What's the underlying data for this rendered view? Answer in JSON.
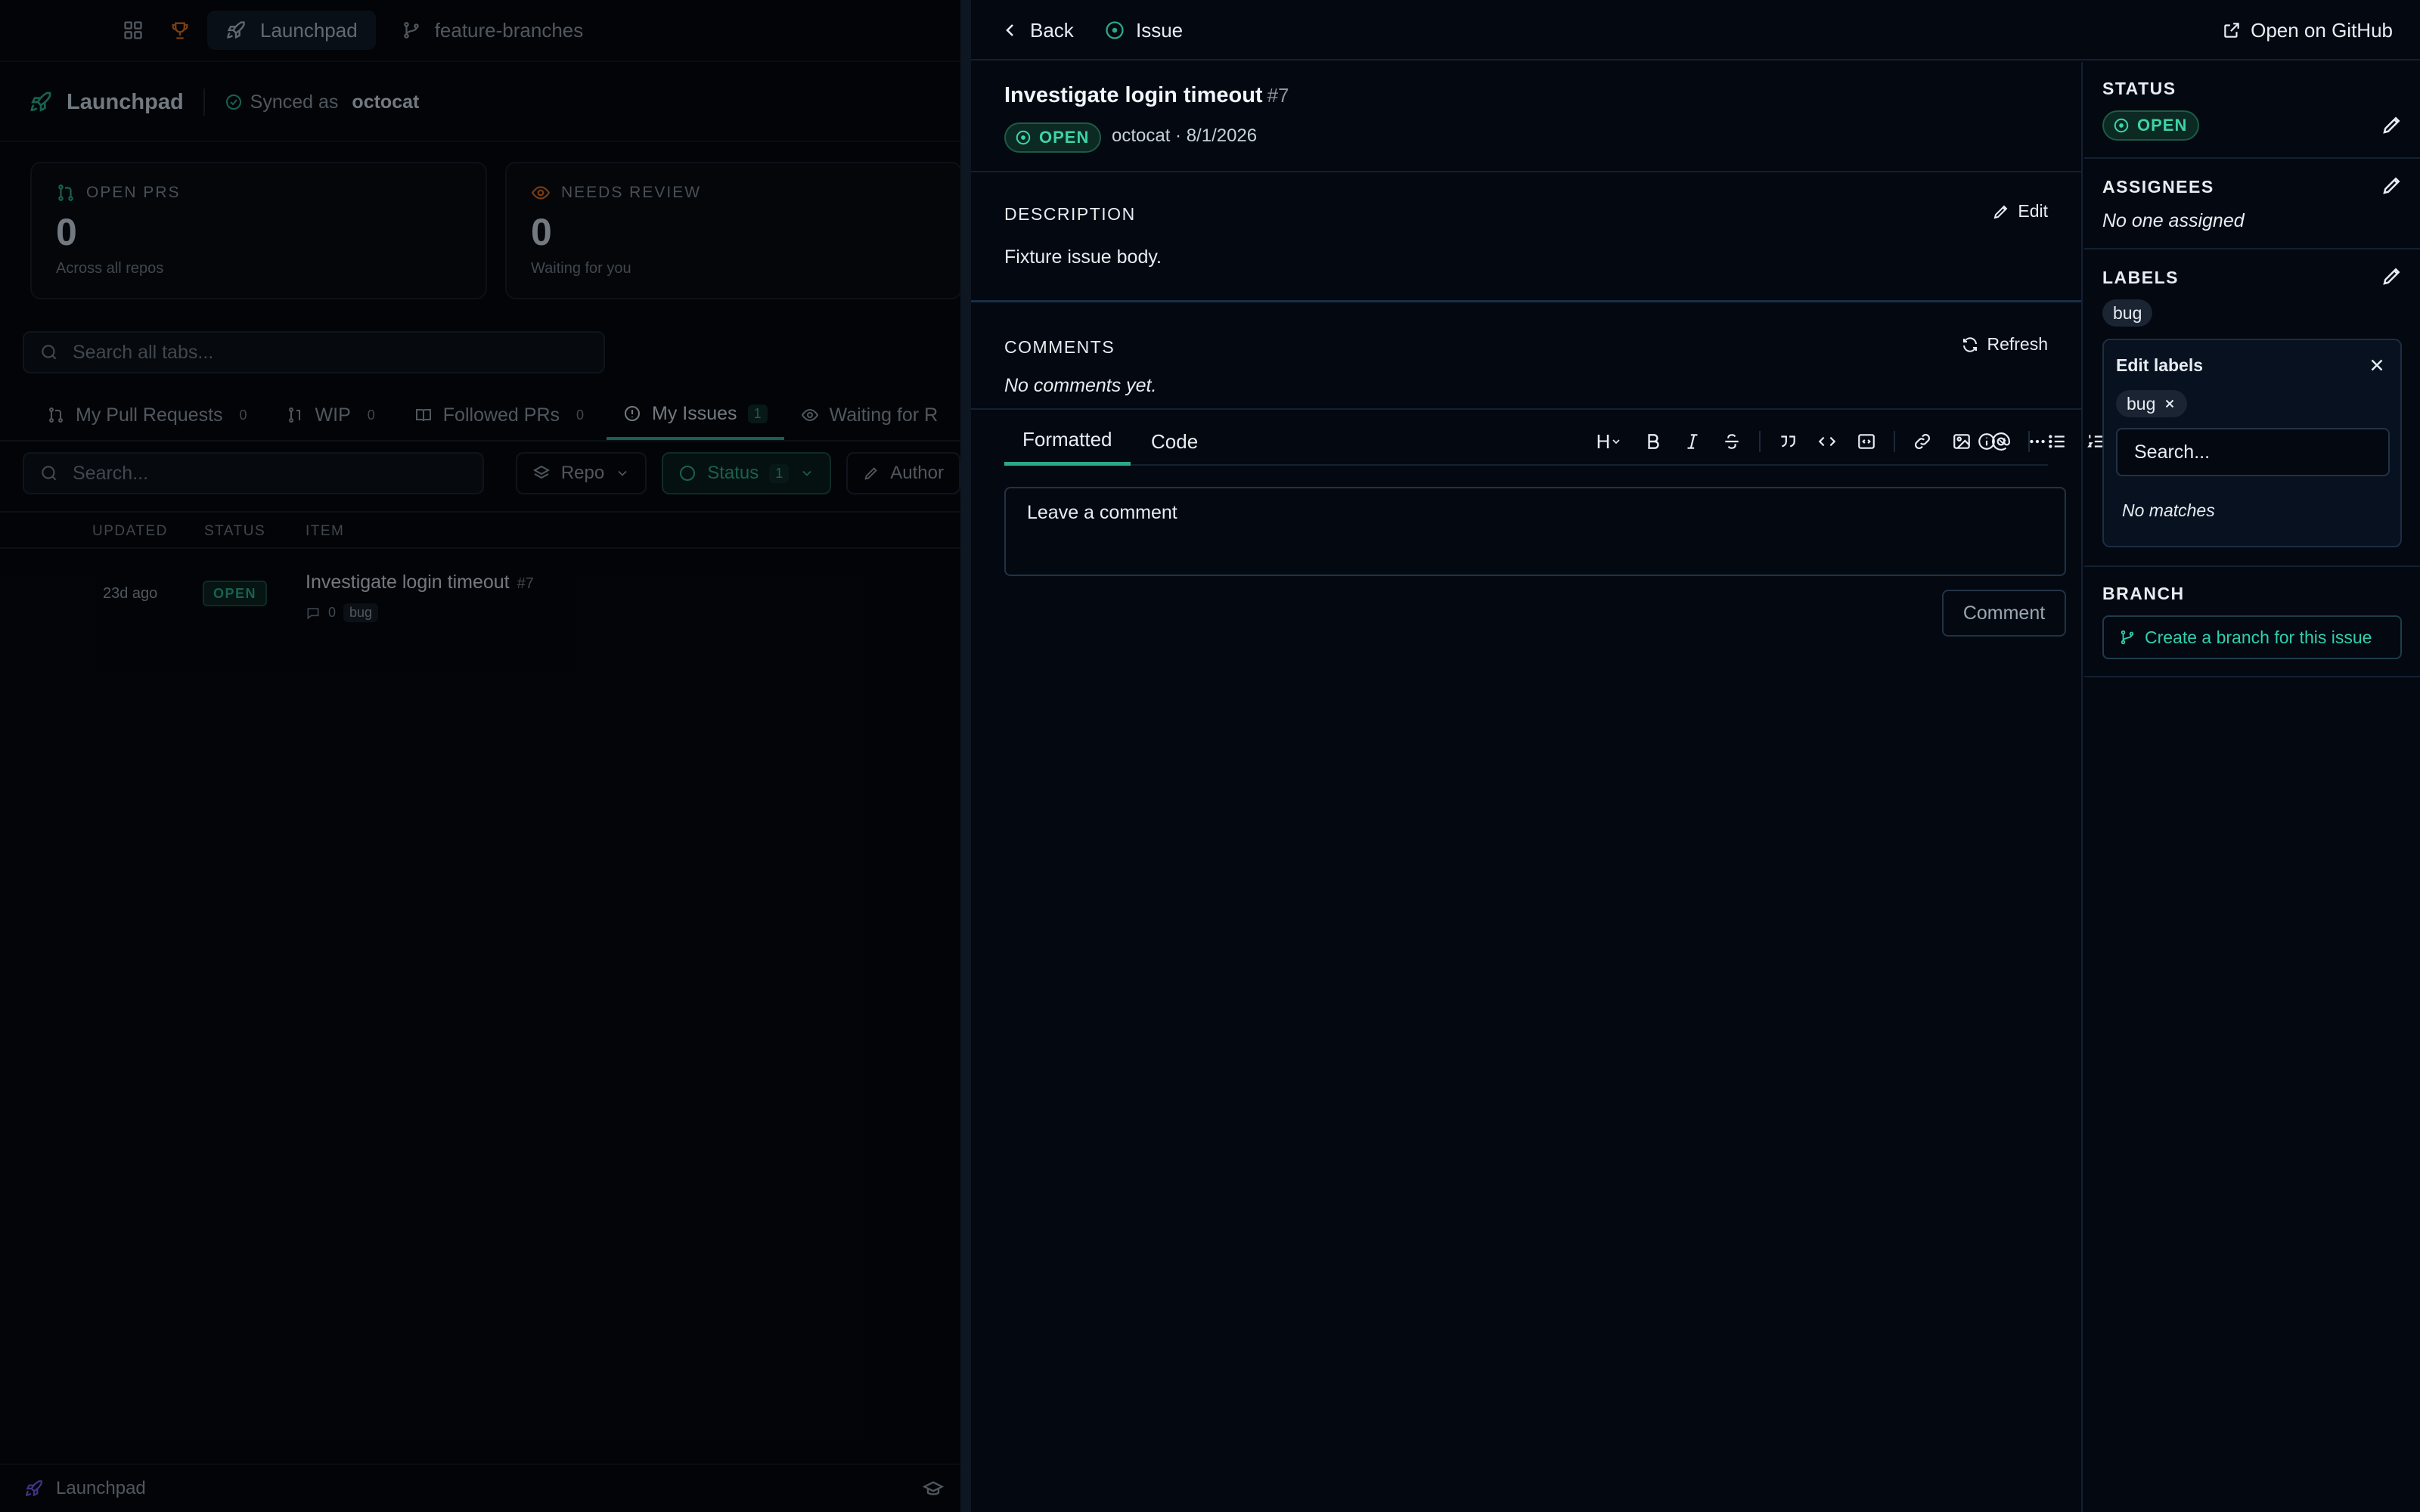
{
  "bg": {
    "nav": {
      "launchpad": "Launchpad",
      "feature_branches": "feature-branches"
    },
    "header": {
      "title": "Launchpad",
      "synced_as": "Synced as",
      "user": "octocat"
    },
    "cards": [
      {
        "label": "OPEN PRS",
        "value": "0",
        "sub": "Across all repos"
      },
      {
        "label": "NEEDS REVIEW",
        "value": "0",
        "sub": "Waiting for you"
      }
    ],
    "search_all_placeholder": "Search all tabs...",
    "tabs": [
      {
        "label": "My Pull Requests",
        "count": "0"
      },
      {
        "label": "WIP",
        "count": "0"
      },
      {
        "label": "Followed PRs",
        "count": "0"
      },
      {
        "label": "My Issues",
        "count": "1"
      },
      {
        "label": "Waiting for R"
      }
    ],
    "search_placeholder": "Search...",
    "filters": {
      "repo": "Repo",
      "status": "Status",
      "status_count": "1",
      "author": "Author"
    },
    "table": {
      "headers": [
        "UPDATED",
        "STATUS",
        "ITEM"
      ],
      "rows": [
        {
          "updated": "23d ago",
          "status": "OPEN",
          "title": "Investigate login timeout",
          "number": "#7",
          "comments": "0",
          "label": "bug"
        }
      ]
    },
    "footer": {
      "label": "Launchpad"
    }
  },
  "drawer": {
    "back": "Back",
    "type": "Issue",
    "open_github": "Open on GitHub",
    "issue": {
      "title": "Investigate login timeout",
      "number": "#7",
      "status": "OPEN",
      "author_date": "octocat · 8/1/2026"
    },
    "description": {
      "label": "DESCRIPTION",
      "edit": "Edit",
      "body": "Fixture issue body."
    },
    "comments": {
      "label": "COMMENTS",
      "refresh": "Refresh",
      "empty": "No comments yet."
    },
    "editor": {
      "tab_formatted": "Formatted",
      "tab_code": "Code",
      "heading_tool": "H",
      "placeholder": "Leave a comment",
      "submit": "Comment"
    },
    "sidebar": {
      "status_label": "STATUS",
      "status": "OPEN",
      "assignees_label": "ASSIGNEES",
      "assignees_empty": "No one assigned",
      "labels_label": "LABELS",
      "labels": [
        "bug"
      ],
      "edit_labels_title": "Edit labels",
      "edit_labels_selected": "bug",
      "label_search_placeholder": "Search...",
      "no_matches": "No matches",
      "branch_label": "BRANCH",
      "create_branch": "Create a branch for this issue"
    }
  },
  "colors": {
    "accent": "#2aa88c",
    "open_green": "#3fd3a6",
    "background": "#03060b",
    "warning": "#d2691e"
  }
}
